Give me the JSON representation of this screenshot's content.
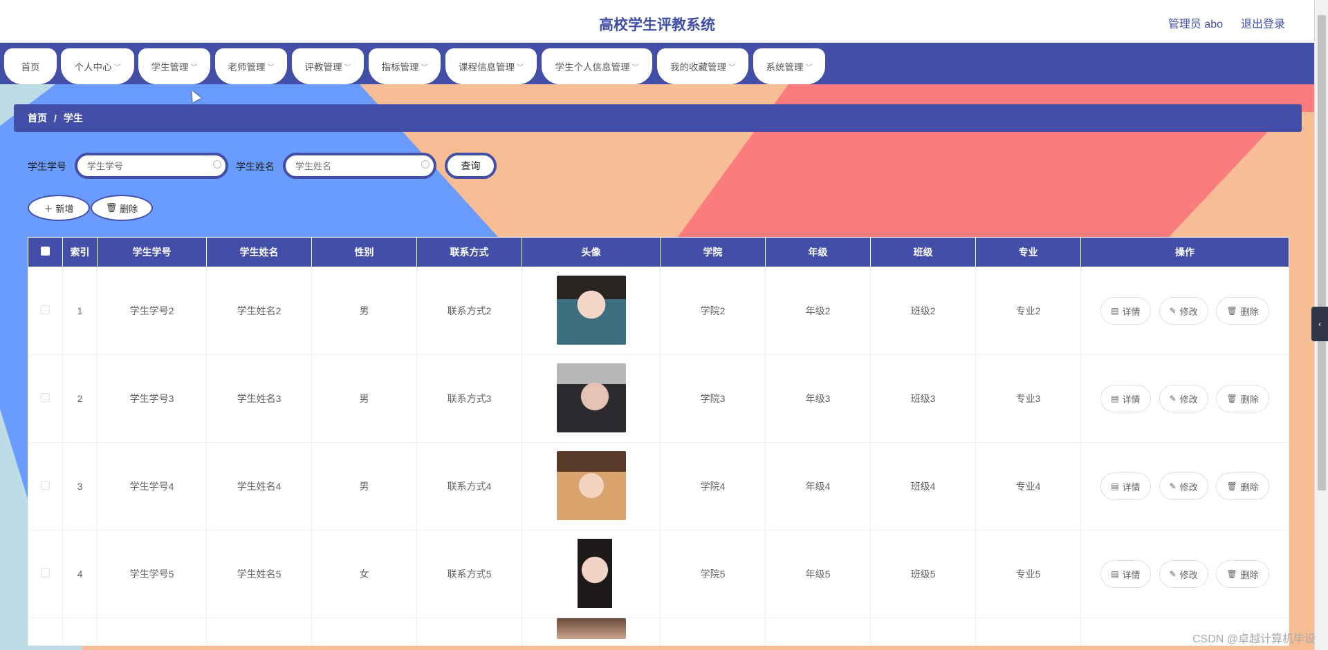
{
  "header": {
    "title": "高校学生评教系统",
    "user": "管理员 abo",
    "logout": "退出登录"
  },
  "nav": [
    {
      "label": "首页",
      "dropdown": false
    },
    {
      "label": "个人中心",
      "dropdown": true
    },
    {
      "label": "学生管理",
      "dropdown": true
    },
    {
      "label": "老师管理",
      "dropdown": true
    },
    {
      "label": "评教管理",
      "dropdown": true
    },
    {
      "label": "指标管理",
      "dropdown": true
    },
    {
      "label": "课程信息管理",
      "dropdown": true
    },
    {
      "label": "学生个人信息管理",
      "dropdown": true
    },
    {
      "label": "我的收藏管理",
      "dropdown": true
    },
    {
      "label": "系统管理",
      "dropdown": true
    }
  ],
  "breadcrumb": {
    "home": "首页",
    "sep": "/",
    "current": "学生"
  },
  "search": {
    "student_no_label": "学生学号",
    "student_no_placeholder": "学生学号",
    "student_name_label": "学生姓名",
    "student_name_placeholder": "学生姓名",
    "query": "查询"
  },
  "actions": {
    "add": "新增",
    "delete": "删除"
  },
  "table": {
    "columns": [
      "索引",
      "学生学号",
      "学生姓名",
      "性别",
      "联系方式",
      "头像",
      "学院",
      "年级",
      "班级",
      "专业",
      "操作"
    ],
    "rows": [
      {
        "index": "1",
        "no": "学生学号2",
        "name": "学生姓名2",
        "gender": "男",
        "contact": "联系方式2",
        "college": "学院2",
        "grade": "年级2",
        "class": "班级2",
        "major": "专业2"
      },
      {
        "index": "2",
        "no": "学生学号3",
        "name": "学生姓名3",
        "gender": "男",
        "contact": "联系方式3",
        "college": "学院3",
        "grade": "年级3",
        "class": "班级3",
        "major": "专业3"
      },
      {
        "index": "3",
        "no": "学生学号4",
        "name": "学生姓名4",
        "gender": "男",
        "contact": "联系方式4",
        "college": "学院4",
        "grade": "年级4",
        "class": "班级4",
        "major": "专业4"
      },
      {
        "index": "4",
        "no": "学生学号5",
        "name": "学生姓名5",
        "gender": "女",
        "contact": "联系方式5",
        "college": "学院5",
        "grade": "年级5",
        "class": "班级5",
        "major": "专业5"
      }
    ],
    "row_ops": {
      "detail": "详情",
      "edit": "修改",
      "delete": "删除"
    }
  },
  "watermark": "CSDN @卓越计算机毕设",
  "colors": {
    "primary": "#424ea7",
    "bg_blue": "#6a9bff",
    "bg_peach": "#f7bd95",
    "bg_red": "#fb7c7e",
    "bg_light": "#bedce6"
  }
}
